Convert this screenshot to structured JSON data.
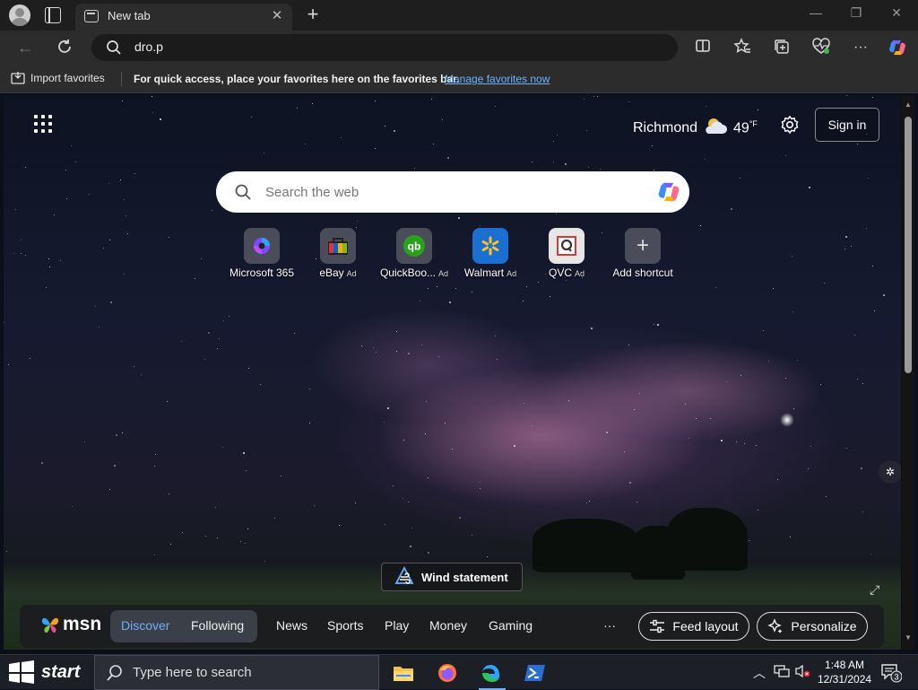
{
  "browser": {
    "tab": {
      "title": "New tab"
    },
    "address": {
      "value": "dro.p"
    },
    "favorites_bar": {
      "import_label": "Import favorites",
      "message": "For quick access, place your favorites here on the favorites bar.",
      "manage_link": "Manage favorites now"
    }
  },
  "newtab": {
    "weather": {
      "city": "Richmond",
      "temp": "49",
      "unit": "°F"
    },
    "sign_in": "Sign in",
    "search": {
      "placeholder": "Search the web"
    },
    "shortcuts": [
      {
        "label": "Microsoft 365",
        "ad": ""
      },
      {
        "label": "eBay",
        "ad": "Ad"
      },
      {
        "label": "QuickBoo...",
        "ad": "Ad"
      },
      {
        "label": "Walmart",
        "ad": "Ad"
      },
      {
        "label": "QVC",
        "ad": "Ad"
      },
      {
        "label": "Add shortcut",
        "ad": ""
      }
    ],
    "wind_button": "Wind statement",
    "msn": {
      "logo": "msn",
      "tabs": [
        "Discover",
        "Following",
        "News",
        "Sports",
        "Play",
        "Money",
        "Gaming"
      ],
      "more": "···",
      "feed_layout": "Feed layout",
      "personalize": "Personalize"
    }
  },
  "taskbar": {
    "start_label": "start",
    "search_placeholder": "Type here to search",
    "time": "1:48 AM",
    "date": "12/31/2024",
    "notification_count": "3"
  }
}
